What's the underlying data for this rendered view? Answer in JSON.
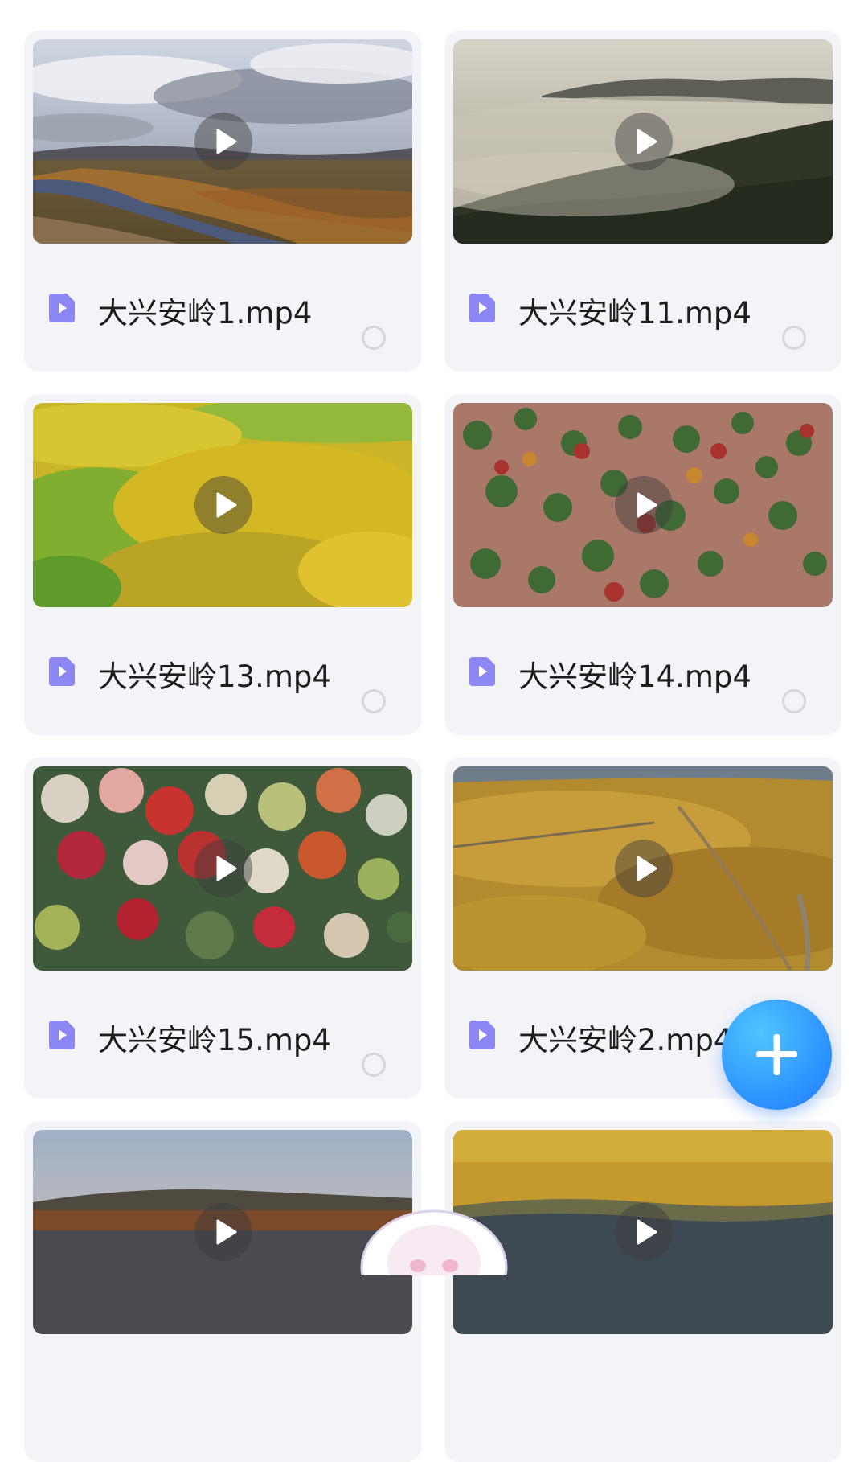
{
  "videos": [
    {
      "name": "大兴安岭1.mp4"
    },
    {
      "name": "大兴安岭11.mp4"
    },
    {
      "name": "大兴安岭13.mp4"
    },
    {
      "name": "大兴安岭14.mp4"
    },
    {
      "name": "大兴安岭15.mp4"
    },
    {
      "name": "大兴安岭2.mp4"
    },
    {
      "name": ""
    },
    {
      "name": ""
    }
  ],
  "icons": {
    "file": "video-file-icon",
    "play": "play-icon",
    "fab": "plus-icon"
  },
  "colors": {
    "card_bg": "#f3f4f8",
    "file_icon": "#8d87f5",
    "fab_gradient_start": "#4fc4ff",
    "fab_gradient_end": "#2a7ff5"
  }
}
